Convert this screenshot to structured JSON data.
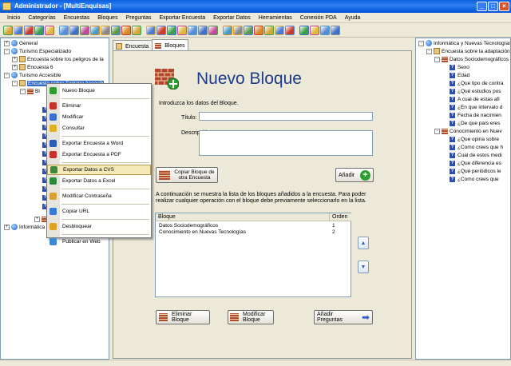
{
  "window": {
    "title": "Administrador - [MultiEnquisas]"
  },
  "menu": [
    "Inicio",
    "Categorías",
    "Encuestas",
    "Bloques",
    "Preguntas",
    "Exportar Encuesta",
    "Exportar Datos",
    "Herramientas",
    "Conexión PDA",
    "Ayuda"
  ],
  "toolbar": {
    "icons": [
      "lock-icon",
      "mail-icon",
      "stop-icon",
      "refresh-icon",
      "folder-icon",
      "mail-icon",
      "save-icon",
      "chart-icon",
      "users-icon",
      "doc-icon",
      "grid-icon",
      "doc-icon",
      "edit-icon",
      "people-icon",
      "key-icon",
      "export-icon",
      "table-icon",
      "chart-icon",
      "chart-icon",
      "doc-icon",
      "pdf-icon",
      "settings-icon",
      "question-icon",
      "pdf-icon",
      "word-icon",
      "excel-icon",
      "doc-icon",
      "plus-icon",
      "print-icon",
      "doc-icon",
      "help-icon"
    ]
  },
  "left_tree": [
    {
      "label": "General",
      "level": 0,
      "icon": "globe",
      "expander": "+"
    },
    {
      "label": "Turismo Especializado",
      "level": 0,
      "icon": "globe",
      "expander": "-"
    },
    {
      "label": "Encuesta sobre los peligros de la",
      "level": 1,
      "icon": "box",
      "expander": "+"
    },
    {
      "label": "Encuesta 6",
      "level": 1,
      "icon": "box",
      "expander": "+"
    },
    {
      "label": "Turismo Accesible",
      "level": 0,
      "icon": "globe",
      "expander": "-"
    },
    {
      "label": "Encuesta sobre Turismo Accesib",
      "level": 1,
      "icon": "box",
      "expander": "-",
      "selected": true
    },
    {
      "label": "Bl",
      "level": 2,
      "icon": "wall",
      "expander": "-"
    },
    {
      "label": "",
      "level": 2,
      "icon": "wall",
      "expander": "+"
    },
    {
      "label": "Informática",
      "level": 0,
      "icon": "globe",
      "expander": "+"
    }
  ],
  "tabs": [
    {
      "label": "Encuesta",
      "active": false
    },
    {
      "label": "Bloques",
      "active": true
    }
  ],
  "form": {
    "title": "Nuevo Bloque",
    "intro": "Introduzca los datos del Bloque.",
    "titulo_label": "Título:",
    "titulo_value": "",
    "descripcion_label": "Descripción:",
    "descripcion_value": "",
    "copy_button": "Copiar Bloque de otra Encuesta",
    "add_button": "Añadir",
    "info_text": "A continuación se muestra la lista de los bloques añadidos a la encuesta. Para poder realizar cualquier operación con el bloque debe previamente seleccionarlo en la lista.",
    "delete_button": "Eliminar Bloque",
    "modify_button": "Modificar Bloque",
    "add_questions_button": "Añadir Preguntas"
  },
  "block_list": {
    "columns": [
      "Bloque",
      "Orden"
    ],
    "rows": [
      {
        "bloque": "Datos Sociodemográficos",
        "orden": "1"
      },
      {
        "bloque": "Conocimiento en Nuevas Tecnologías",
        "orden": "2"
      }
    ]
  },
  "context_menu": [
    {
      "label": "Nuevo Bloque",
      "icon": "plus-icon"
    },
    {
      "sep": true
    },
    {
      "label": "Eliminar",
      "icon": "delete-icon"
    },
    {
      "label": "Modificar",
      "icon": "edit-icon"
    },
    {
      "label": "Consultar",
      "icon": "star-icon"
    },
    {
      "sep": true
    },
    {
      "label": "Exportar Encuesta a Word",
      "icon": "word-icon"
    },
    {
      "label": "Exportar Encuesta a PDF",
      "icon": "pdf-icon"
    },
    {
      "sep": true
    },
    {
      "label": "Exportar Datos a CVS",
      "icon": "csv-icon",
      "highlighted": true
    },
    {
      "label": "Exportar Datos a Excel",
      "icon": "excel-icon"
    },
    {
      "sep": true
    },
    {
      "label": "Modificar Contraseña",
      "icon": "key-icon"
    },
    {
      "sep": true
    },
    {
      "label": "Copiar URL",
      "icon": "link-icon"
    },
    {
      "sep": true
    },
    {
      "label": "Desbloquear",
      "icon": "unlock-icon"
    },
    {
      "sep": true
    },
    {
      "label": "Publicar en Web",
      "icon": "web-icon"
    }
  ],
  "right_tree": [
    {
      "label": "Informática y Nuevas Tecnologías",
      "level": 0,
      "icon": "globe",
      "expander": "-"
    },
    {
      "label": "Encuesta sobre la adaptación",
      "level": 1,
      "icon": "box",
      "expander": "-"
    },
    {
      "label": "Datos Sociodemográficos",
      "level": 2,
      "icon": "wall",
      "expander": "-"
    },
    {
      "label": "Sexo",
      "level": 3,
      "icon": "q"
    },
    {
      "label": "Edad",
      "level": 3,
      "icon": "q"
    },
    {
      "label": "¿Que tipo de contra",
      "level": 3,
      "icon": "q"
    },
    {
      "label": "¿Qué estudios pos",
      "level": 3,
      "icon": "q"
    },
    {
      "label": "A cual de estas afi",
      "level": 3,
      "icon": "q"
    },
    {
      "label": "¿En que intervalo d",
      "level": 3,
      "icon": "q"
    },
    {
      "label": "Fecha de nacimien",
      "level": 3,
      "icon": "q"
    },
    {
      "label": "¿De que país eres",
      "level": 3,
      "icon": "q"
    },
    {
      "label": "Conocimiento en Nuev",
      "level": 2,
      "icon": "wall",
      "expander": "-"
    },
    {
      "label": "¿Que opina sobre",
      "level": 3,
      "icon": "q"
    },
    {
      "label": "¿Como crees que h",
      "level": 3,
      "icon": "q"
    },
    {
      "label": "Cual de estos medi",
      "level": 3,
      "icon": "q"
    },
    {
      "label": "¿Que diferencia es",
      "level": 3,
      "icon": "q"
    },
    {
      "label": "¿Qué periódicos le",
      "level": 3,
      "icon": "q"
    },
    {
      "label": "¿Como crees que",
      "level": 3,
      "icon": "q"
    }
  ]
}
